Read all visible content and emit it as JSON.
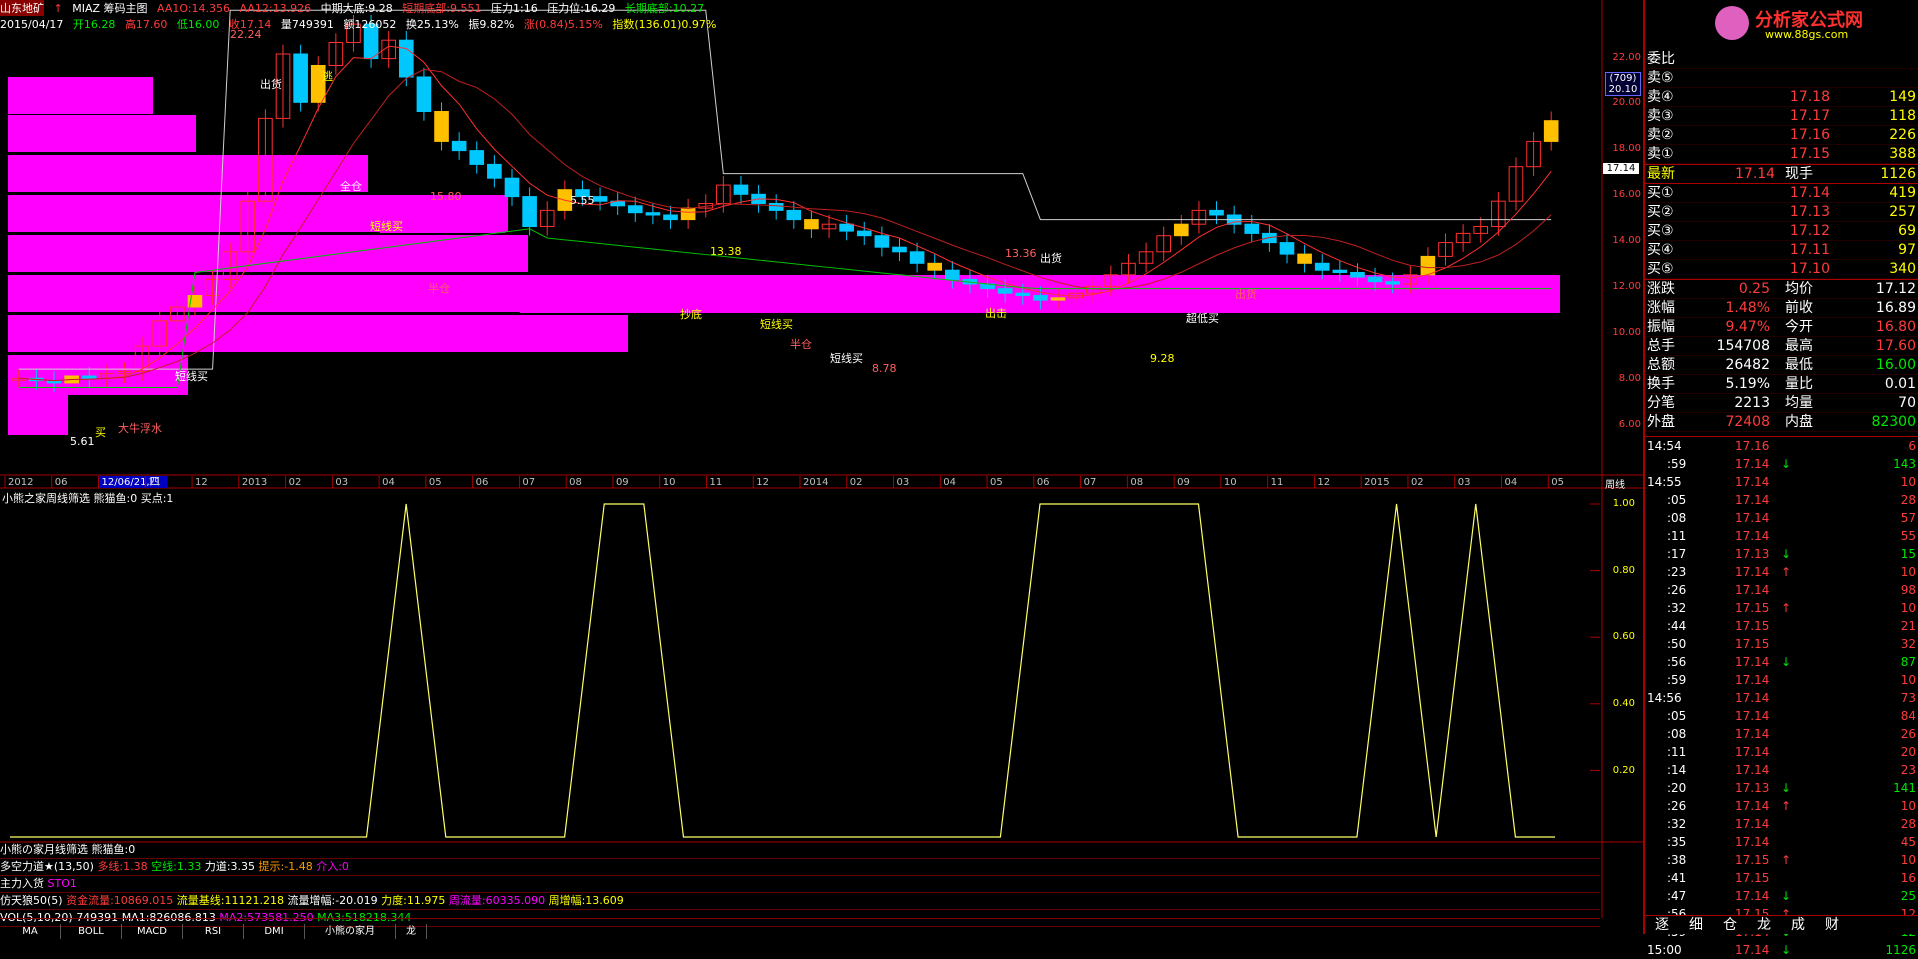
{
  "header": {
    "stock_name": "山东地矿",
    "code_label": "MIAZ 筹码主图",
    "aa1": "AA1O:14.356",
    "aa12": "AA12:13.926",
    "mid_bottom": "中期大底:9.28",
    "short_bottom": "短期底部:9.551",
    "pressure1": "压力1:16",
    "pressure_pos": "压力位:16.29",
    "long_bottom": "长期底部:10.27",
    "date": "2015/04/17",
    "open": "开16.28",
    "high": "高17.60",
    "low": "低16.00",
    "close": "收17.14",
    "volume": "量749391",
    "amount": "额126052",
    "turnover": "换25.13%",
    "amplitude": "振9.82%",
    "change": "涨(0.84)5.15%",
    "index": "指数(136.01)0.97%"
  },
  "main_chart": {
    "price_labels": [
      "22.00",
      "20.00",
      "18.00",
      "16.00",
      "14.00",
      "12.00",
      "10.00",
      "8.00",
      "6.00"
    ],
    "current_price": "17.14",
    "boxed_values": [
      "(709)",
      "20.10"
    ],
    "time_labels": [
      "2012",
      "06",
      "12/06/21,四",
      "11",
      "12",
      "2013",
      "02",
      "03",
      "04",
      "05",
      "06",
      "07",
      "08",
      "09",
      "10",
      "11",
      "12",
      "2014",
      "02",
      "03",
      "04",
      "05",
      "06",
      "07",
      "08",
      "09",
      "10",
      "11",
      "12",
      "2015",
      "02",
      "03",
      "04",
      "05"
    ],
    "period": "周线",
    "annotations": [
      "22.24",
      "出货",
      "逃",
      "15.80",
      "全仓",
      "短线买",
      "半仓",
      "5.55",
      "13.38",
      "13.36",
      "出货",
      "短线买",
      "半仓",
      "短线买",
      "抄底",
      "8.78",
      "5.61",
      "买",
      "大牛浮水",
      "短线买",
      "出击",
      "出货",
      "超低买",
      "9.28"
    ]
  },
  "chart_data": {
    "type": "line",
    "title": "小熊之家周线筛选 熊猫鱼:0 买点:1",
    "ylim": [
      0,
      1
    ],
    "y_ticks": [
      "1.00",
      "0.80",
      "0.60",
      "0.40",
      "0.20"
    ],
    "x": [
      0,
      1,
      2,
      3,
      4,
      5,
      6,
      7,
      8,
      9,
      10,
      11,
      12,
      13,
      14,
      15,
      16,
      17,
      18,
      19,
      20,
      21,
      22,
      23,
      24,
      25,
      26,
      27,
      28,
      29,
      30,
      31,
      32,
      33,
      34,
      35,
      36,
      37,
      38,
      39
    ],
    "values": [
      0,
      0,
      0,
      0,
      0,
      0,
      0,
      0,
      0,
      0,
      1,
      0,
      0,
      0,
      0,
      1,
      1,
      0,
      0,
      0,
      0,
      0,
      0,
      0,
      0,
      0,
      1,
      1,
      1,
      1,
      1,
      0,
      0,
      0,
      0,
      1,
      0,
      1,
      0,
      0
    ]
  },
  "indicators": {
    "row1": "小熊の家月线筛选 熊猫鱼:0",
    "row2_name": "多空力道★(13,50)",
    "row2_vals": [
      "多线:1.38",
      "空线:1.33",
      "力道:3.35",
      "提示:-1.48",
      "介入:0"
    ],
    "row3_name": "主力入货",
    "row3_vals": [
      "STO1"
    ],
    "row4_name": "仿天狼50(5)",
    "row4_vals": [
      "资金流量:10869.015",
      "流量基线:11121.218",
      "流量增幅:-20.019",
      "力度:11.975",
      "周流量:60335.090",
      "周增幅:13.609"
    ],
    "row5_name": "VOL(5,10,20)",
    "row5_vals": [
      "749391",
      "MA1:826086.813",
      "MA2:573581.250",
      "MA3:518218.344"
    ]
  },
  "tabs": [
    "MA",
    "BOLL",
    "MACD",
    "RSI",
    "DMI",
    "小熊の家月",
    "龙"
  ],
  "logo": {
    "text": "分析家公式网",
    "url_text": "www.88gs.com"
  },
  "quote": {
    "wei_bi_label": "委比",
    "sell": [
      {
        "label": "卖⑤",
        "price": "",
        "vol": ""
      },
      {
        "label": "卖④",
        "price": "17.18",
        "vol": "149"
      },
      {
        "label": "卖③",
        "price": "17.17",
        "vol": "118"
      },
      {
        "label": "卖②",
        "price": "17.16",
        "vol": "226"
      },
      {
        "label": "卖①",
        "price": "17.15",
        "vol": "388"
      }
    ],
    "latest": {
      "label": "最新",
      "price": "17.14",
      "label2": "现手",
      "vol": "1126"
    },
    "buy": [
      {
        "label": "买①",
        "price": "17.14",
        "vol": "419"
      },
      {
        "label": "买②",
        "price": "17.13",
        "vol": "257"
      },
      {
        "label": "买③",
        "price": "17.12",
        "vol": "69"
      },
      {
        "label": "买④",
        "price": "17.11",
        "vol": "97"
      },
      {
        "label": "买⑤",
        "price": "17.10",
        "vol": "340"
      }
    ],
    "stats": [
      {
        "l1": "涨跌",
        "v1": "0.25",
        "l2": "均价",
        "v2": "17.12"
      },
      {
        "l1": "涨幅",
        "v1": "1.48%",
        "l2": "前收",
        "v2": "16.89"
      },
      {
        "l1": "振幅",
        "v1": "9.47%",
        "l2": "今开",
        "v2": "16.80"
      },
      {
        "l1": "总手",
        "v1": "154708",
        "l2": "最高",
        "v2": "17.60"
      },
      {
        "l1": "总额",
        "v1": "26482",
        "l2": "最低",
        "v2": "16.00"
      },
      {
        "l1": "换手",
        "v1": "5.19%",
        "l2": "量比",
        "v2": "0.01"
      },
      {
        "l1": "分笔",
        "v1": "2213",
        "l2": "均量",
        "v2": "70"
      },
      {
        "l1": "外盘",
        "v1": "72408",
        "l2": "内盘",
        "v2": "82300"
      }
    ]
  },
  "ticks": [
    {
      "t": "14:54",
      "p": "17.16",
      "a": "",
      "v": "6"
    },
    {
      "t": ":59",
      "p": "17.14",
      "a": "↓",
      "v": "143"
    },
    {
      "t": "14:55",
      "p": "17.14",
      "a": "",
      "v": "10"
    },
    {
      "t": ":05",
      "p": "17.14",
      "a": "",
      "v": "28"
    },
    {
      "t": ":08",
      "p": "17.14",
      "a": "",
      "v": "57"
    },
    {
      "t": ":11",
      "p": "17.14",
      "a": "",
      "v": "55"
    },
    {
      "t": ":17",
      "p": "17.13",
      "a": "↓",
      "v": "15"
    },
    {
      "t": ":23",
      "p": "17.14",
      "a": "↑",
      "v": "10"
    },
    {
      "t": ":26",
      "p": "17.14",
      "a": "",
      "v": "98"
    },
    {
      "t": ":32",
      "p": "17.15",
      "a": "↑",
      "v": "10"
    },
    {
      "t": ":44",
      "p": "17.15",
      "a": "",
      "v": "21"
    },
    {
      "t": ":50",
      "p": "17.15",
      "a": "",
      "v": "32"
    },
    {
      "t": ":56",
      "p": "17.14",
      "a": "↓",
      "v": "87"
    },
    {
      "t": ":59",
      "p": "17.14",
      "a": "",
      "v": "10"
    },
    {
      "t": "14:56",
      "p": "17.14",
      "a": "",
      "v": "73"
    },
    {
      "t": ":05",
      "p": "17.14",
      "a": "",
      "v": "84"
    },
    {
      "t": ":08",
      "p": "17.14",
      "a": "",
      "v": "26"
    },
    {
      "t": ":11",
      "p": "17.14",
      "a": "",
      "v": "20"
    },
    {
      "t": ":14",
      "p": "17.14",
      "a": "",
      "v": "23"
    },
    {
      "t": ":20",
      "p": "17.13",
      "a": "↓",
      "v": "141"
    },
    {
      "t": ":26",
      "p": "17.14",
      "a": "↑",
      "v": "10"
    },
    {
      "t": ":32",
      "p": "17.14",
      "a": "",
      "v": "28"
    },
    {
      "t": ":35",
      "p": "17.14",
      "a": "",
      "v": "45"
    },
    {
      "t": ":38",
      "p": "17.15",
      "a": "↑",
      "v": "10"
    },
    {
      "t": ":41",
      "p": "17.15",
      "a": "",
      "v": "16"
    },
    {
      "t": ":47",
      "p": "17.14",
      "a": "↓",
      "v": "25"
    },
    {
      "t": ":56",
      "p": "17.15",
      "a": "↑",
      "v": "12"
    },
    {
      "t": ":59",
      "p": "17.14",
      "a": "↓",
      "v": "12"
    },
    {
      "t": "15:00",
      "p": "17.14",
      "a": "↓",
      "v": "1126"
    }
  ],
  "nav": [
    "逐",
    "细",
    "仓",
    "龙",
    "成",
    "财"
  ]
}
